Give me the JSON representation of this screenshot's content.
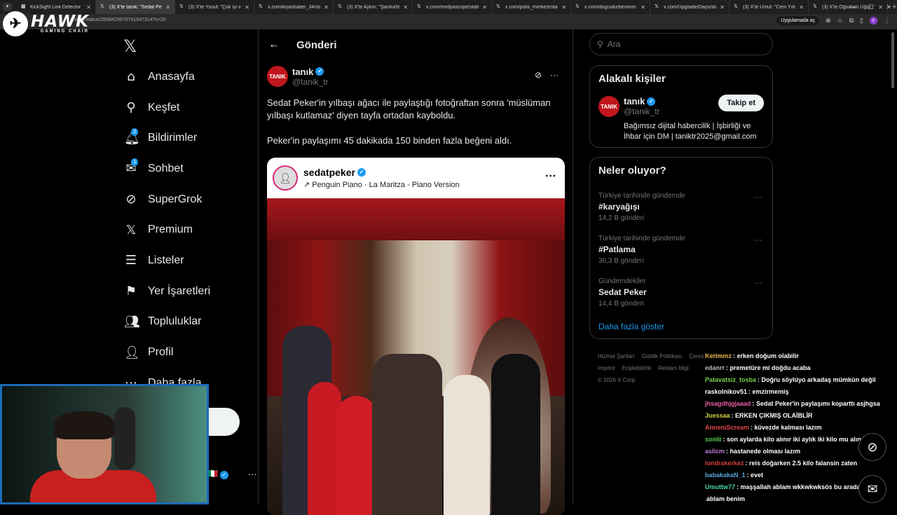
{
  "browser": {
    "tabs": [
      {
        "label": "KickSight Link Detector",
        "icon": "grid-icon",
        "active": false
      },
      {
        "label": "(3) X'te tanık: \"Sedat Peker'",
        "icon": "x-logo-icon",
        "active": true
      },
      {
        "label": "(3) X'te Yusuf: \"Çok iyi vid",
        "icon": "x-logo-icon",
        "active": false
      },
      {
        "label": "x.com/kiyashaber_34/stat",
        "icon": "x-logo-icon",
        "active": false
      },
      {
        "label": "(3) X'te Aykırı: \"Şanlıurfa'",
        "icon": "x-logo-icon",
        "active": false
      },
      {
        "label": "x.com/medyascope/statu",
        "icon": "x-logo-icon",
        "active": false
      },
      {
        "label": "x.com/polis_merkezi/stati",
        "icon": "x-logo-icon",
        "active": false
      },
      {
        "label": "x.com/dogrudurbenimm",
        "icon": "x-logo-icon",
        "active": false
      },
      {
        "label": "x.com/UpgraderDays/stat",
        "icon": "x-logo-icon",
        "active": false
      },
      {
        "label": "(3) X'te Umut: \"Cem Yılm",
        "icon": "x-logo-icon",
        "active": false
      },
      {
        "label": "(3) X'te Oğuzhan Uğur: \"",
        "icon": "x-logo-icon",
        "active": false
      }
    ],
    "url": "anik_tr/status/2006429670791647314?s=20",
    "app_pill": "Uygulamada aç",
    "profile_initial": "c"
  },
  "overlay": {
    "brand": "HAWK",
    "brand_sub": "GAMING CHAIR"
  },
  "sidebar": {
    "items": [
      {
        "label": "Anasayfa",
        "icon": "home-icon",
        "glyph": "⌂"
      },
      {
        "label": "Keşfet",
        "icon": "search-icon",
        "glyph": "⚲"
      },
      {
        "label": "Bildirimler",
        "icon": "bell-icon",
        "glyph": "🔔︎",
        "badge": "2"
      },
      {
        "label": "Sohbet",
        "icon": "mail-icon",
        "glyph": "✉",
        "badge": "1"
      },
      {
        "label": "SuperGrok",
        "icon": "grok-icon",
        "glyph": "⊘"
      },
      {
        "label": "Premium",
        "icon": "x-logo-icon",
        "glyph": "𝕏"
      },
      {
        "label": "Listeler",
        "icon": "list-icon",
        "glyph": "☰"
      },
      {
        "label": "Yer İşaretleri",
        "icon": "bookmark-icon",
        "glyph": "⚑"
      },
      {
        "label": "Topluluklar",
        "icon": "communities-icon",
        "glyph": "👥︎"
      },
      {
        "label": "Profil",
        "icon": "profile-icon",
        "glyph": "👤︎"
      },
      {
        "label": "Daha fazla",
        "icon": "more-circle-icon",
        "glyph": "⋯"
      }
    ],
    "post_button_partial": "a",
    "more_dots": "···"
  },
  "main": {
    "header_title": "Gönderi",
    "tweet": {
      "avatar_text": "TANIK",
      "author": "tanık",
      "handle": "@tanik_tr",
      "text1": "Sedat Peker'in yılbaşı ağacı ile paylaştığı fotoğraftan sonra 'müslüman yılbaşı kutlamaz' diyen tayfa ortadan kayboldu.",
      "text2": "Peker'in paylaşımı 45 dakikada 150 binden fazla beğeni aldı.",
      "embed": {
        "username": "sedatpeker",
        "song": "Penguin Piano · La Maritza - Piano Version",
        "more": "···"
      }
    }
  },
  "right": {
    "search_placeholder": "Ara",
    "related_title": "Alakalı kişiler",
    "related": {
      "avatar_text": "TANIK",
      "name": "tanık",
      "handle": "@tanik_tr",
      "follow_label": "Takip et",
      "bio": "Bağımsız dijital habercilik | İşbirliği ve İhbar için DM | taniktr2025@gmail.com"
    },
    "trends_title": "Neler oluyor?",
    "trends": [
      {
        "context": "Türkiye tarihinde gündemde",
        "name": "#karyağışı",
        "count": "14,2 B gönderi"
      },
      {
        "context": "Türkiye tarihinde gündemde",
        "name": "#Patlama",
        "count": "36,3 B gönderi"
      },
      {
        "context": "Gündemdekiler",
        "name": "Sedat Peker",
        "count": "14,4 B gönderi"
      }
    ],
    "show_more": "Daha fazla göster",
    "footer": {
      "links1": [
        "Hizmet Şartları",
        "Gizlilik Politikası",
        "Çerez Politikası"
      ],
      "links2": [
        "Imprint",
        "Erişilebilirlik",
        "Reklam bilgi"
      ],
      "copyright": "© 2026 X Corp."
    }
  },
  "chat": [
    {
      "user": "Kerimmz",
      "color": "#e0b040",
      "text": ": erken doğum olabilir"
    },
    {
      "user": "edanrr",
      "color": "#bbbbbb",
      "text": ": premetüre mi doğdu acaba"
    },
    {
      "user": "Patavatsiz_tosba",
      "color": "#7ad14f",
      "text": ": Doğru söylüyo arkadaş mümkün değil"
    },
    {
      "user": "raskolnikov51",
      "color": "#ffffff",
      "text": ": emzirmemiş"
    },
    {
      "user": "jhsagdhjgjaaad",
      "color": "#e85fa0",
      "text": ": Sedat Peker'in paylaşımı koparttı asjhgsa"
    },
    {
      "user": "Juessaa",
      "color": "#d3d34a",
      "text": ": ERKEN ÇIKMIŞ OLAİBLİR"
    },
    {
      "user": "AnneniScream",
      "color": "#e04848",
      "text": ": küvezde kalması lazım"
    },
    {
      "user": "sonlii",
      "color": "#4fd14f",
      "text": ": son aylarda kilo alınır iki aylık iki kilo mu alınır hiç"
    },
    {
      "user": "aslicm",
      "color": "#c07ad8",
      "text": ": hastanede olması lazım"
    },
    {
      "user": "londrakerkez",
      "color": "#d04040",
      "text": ": reis doğarken 2.5 kilo falansin zaten"
    },
    {
      "user": "babakakaN_1",
      "color": "#58a6d8",
      "text": ": evet"
    },
    {
      "user": "Umuttw77",
      "color": "#4ad1b0",
      "text": ": maşşallah ablam wkkwkwksös bu arada nasılsın"
    },
    {
      "user": "",
      "color": "#ffffff",
      "text": "ablam benim"
    }
  ],
  "colors": {
    "accent": "#1d9bf0",
    "bg": "#000000",
    "border": "#2f3336",
    "cam_border": "#1d6ab8"
  }
}
